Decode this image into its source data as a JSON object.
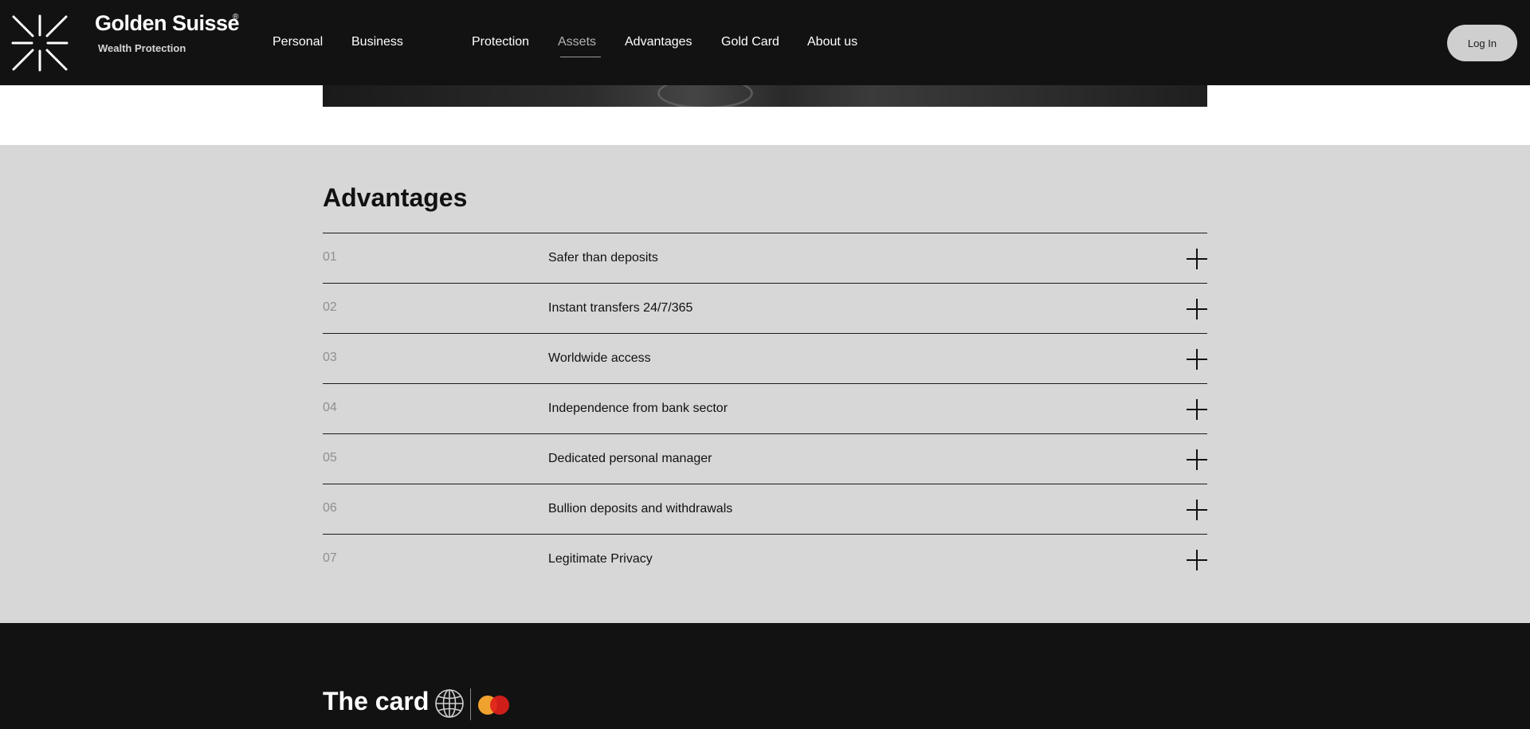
{
  "header": {
    "brand_name": "Golden Suisse",
    "brand_reg": "®",
    "brand_tagline": "Wealth Protection",
    "nav": [
      {
        "label": "Personal"
      },
      {
        "label": "Business"
      },
      {
        "label": "Protection"
      },
      {
        "label": "Assets",
        "active": true
      },
      {
        "label": "Advantages"
      },
      {
        "label": "Gold Card"
      },
      {
        "label": "About us"
      }
    ],
    "login_label": "Log In"
  },
  "advantages": {
    "title": "Advantages",
    "items": [
      {
        "num": "01",
        "label": "Safer than deposits"
      },
      {
        "num": "02",
        "label": "Instant transfers 24/7/365"
      },
      {
        "num": "03",
        "label": "Worldwide access"
      },
      {
        "num": "04",
        "label": "Independence from bank sector"
      },
      {
        "num": "05",
        "label": "Dedicated personal manager"
      },
      {
        "num": "06",
        "label": "Bullion deposits and withdrawals"
      },
      {
        "num": "07",
        "label": "Legitimate Privacy"
      }
    ]
  },
  "card_section": {
    "title": "The card",
    "icons": [
      "globe-icon",
      "mastercard-icon"
    ]
  },
  "colors": {
    "header_bg": "#121212",
    "section_bg": "#d7d7d7",
    "text_dark": "#111111",
    "number_gray": "#8f8f8f",
    "mastercard_orange": "#f0a22e",
    "mastercard_red": "#e0201b"
  }
}
